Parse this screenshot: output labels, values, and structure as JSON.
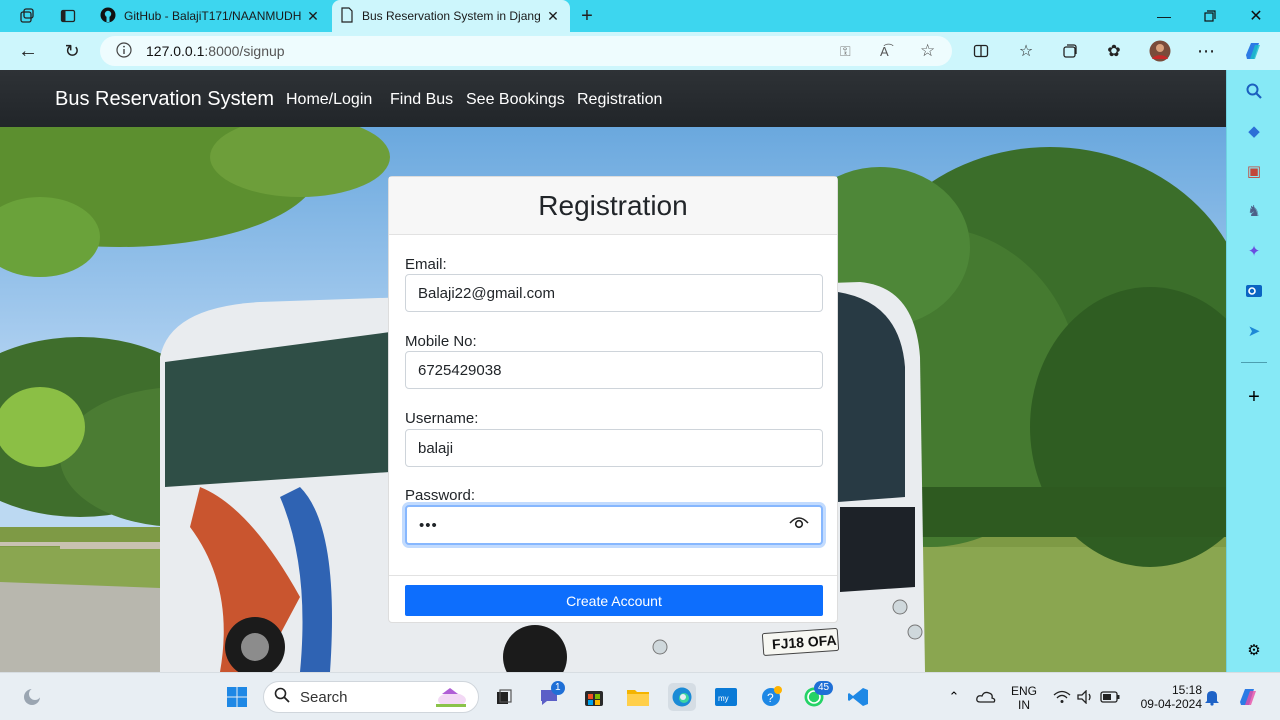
{
  "browser": {
    "tabs": [
      {
        "title": "GitHub - BalajiT171/NAANMUDH",
        "icon": "github-icon"
      },
      {
        "title": "Bus Reservation System in Djang",
        "icon": "document-icon"
      }
    ],
    "url_host": "127.0.0.1",
    "url_path": ":8000/signup"
  },
  "navbar": {
    "brand": "Bus Reservation System",
    "links": [
      "Home/Login",
      "Find Bus",
      "See Bookings",
      "Registration"
    ]
  },
  "form": {
    "title": "Registration",
    "email_label": "Email:",
    "email_value": "Balaji22@gmail.com",
    "mobile_label": "Mobile No:",
    "mobile_value": "6725429038",
    "username_label": "Username:",
    "username_value": "balaji",
    "password_label": "Password:",
    "password_value": "•••",
    "submit_label": "Create Account"
  },
  "scene": {
    "plate": "FJ18 OFA"
  },
  "taskbar": {
    "search_label": "Search",
    "teams_badge": "1",
    "whatsapp_badge": "45",
    "lang_line1": "ENG",
    "lang_line2": "IN",
    "time": "15:18",
    "date": "09-04-2024"
  },
  "colors": {
    "tabbar": "#3dd6ef",
    "navbar": "#212529",
    "primary_button": "#0d6efd",
    "sidebar": "#86e9f6"
  }
}
